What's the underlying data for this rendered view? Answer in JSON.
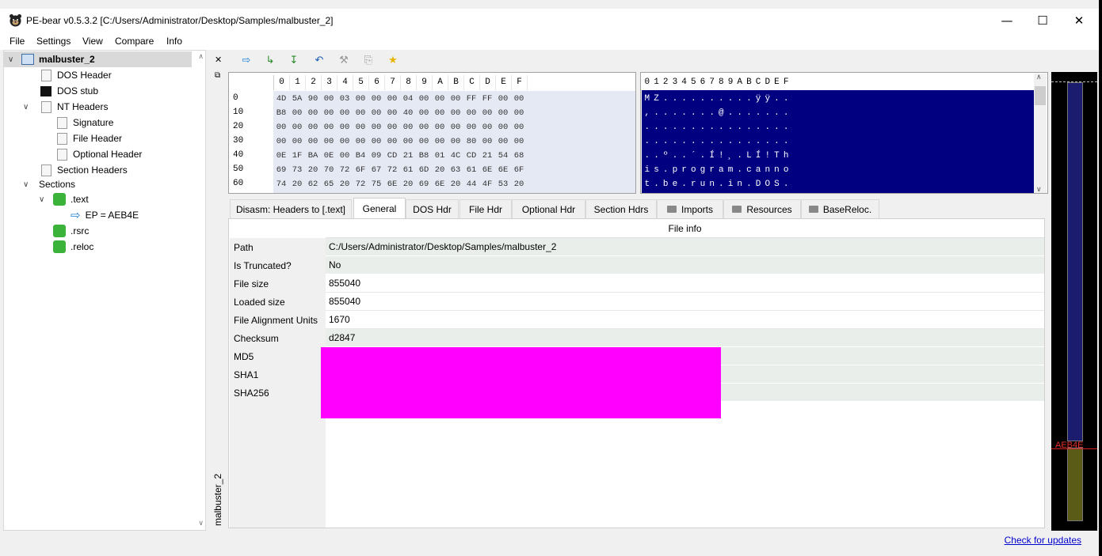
{
  "window": {
    "title": "PE-bear v0.5.3.2 [C:/Users/Administrator/Desktop/Samples/malbuster_2]",
    "controls": {
      "minimize": "—",
      "maximize": "☐",
      "close": "✕"
    }
  },
  "menu": [
    "File",
    "Settings",
    "View",
    "Compare",
    "Info"
  ],
  "tree": {
    "root": "malbuster_2",
    "items": {
      "dos_header": "DOS Header",
      "dos_stub": "DOS stub",
      "nt_headers": "NT Headers",
      "signature": "Signature",
      "file_header": "File Header",
      "optional_header": "Optional Header",
      "section_headers": "Section Headers",
      "sections": "Sections",
      "text": ".text",
      "ep": "EP = AEB4E",
      "rsrc": ".rsrc",
      "reloc": ".reloc"
    }
  },
  "side_strip": {
    "close": "✕",
    "float": "⧉",
    "vertical_label": "malbuster_2"
  },
  "toolbar": [
    "go-to-arrow-icon",
    "add-section-icon",
    "save-icon",
    "undo-icon",
    "pin-icon",
    "copy-icon",
    "star-icon"
  ],
  "hex": {
    "columns": [
      "0",
      "1",
      "2",
      "3",
      "4",
      "5",
      "6",
      "7",
      "8",
      "9",
      "A",
      "B",
      "C",
      "D",
      "E",
      "F"
    ],
    "rows": [
      {
        "offset": "0",
        "bytes": [
          "4D",
          "5A",
          "90",
          "00",
          "03",
          "00",
          "00",
          "00",
          "04",
          "00",
          "00",
          "00",
          "FF",
          "FF",
          "00",
          "00"
        ]
      },
      {
        "offset": "10",
        "bytes": [
          "B8",
          "00",
          "00",
          "00",
          "00",
          "00",
          "00",
          "00",
          "40",
          "00",
          "00",
          "00",
          "00",
          "00",
          "00",
          "00"
        ]
      },
      {
        "offset": "20",
        "bytes": [
          "00",
          "00",
          "00",
          "00",
          "00",
          "00",
          "00",
          "00",
          "00",
          "00",
          "00",
          "00",
          "00",
          "00",
          "00",
          "00"
        ]
      },
      {
        "offset": "30",
        "bytes": [
          "00",
          "00",
          "00",
          "00",
          "00",
          "00",
          "00",
          "00",
          "00",
          "00",
          "00",
          "00",
          "80",
          "00",
          "00",
          "00"
        ]
      },
      {
        "offset": "40",
        "bytes": [
          "0E",
          "1F",
          "BA",
          "0E",
          "00",
          "B4",
          "09",
          "CD",
          "21",
          "B8",
          "01",
          "4C",
          "CD",
          "21",
          "54",
          "68"
        ]
      },
      {
        "offset": "50",
        "bytes": [
          "69",
          "73",
          "20",
          "70",
          "72",
          "6F",
          "67",
          "72",
          "61",
          "6D",
          "20",
          "63",
          "61",
          "6E",
          "6E",
          "6F"
        ]
      },
      {
        "offset": "60",
        "bytes": [
          "74",
          "20",
          "62",
          "65",
          "20",
          "72",
          "75",
          "6E",
          "20",
          "69",
          "6E",
          "20",
          "44",
          "4F",
          "53",
          "20"
        ]
      }
    ]
  },
  "ascii": {
    "columns": [
      "0",
      "1",
      "2",
      "3",
      "4",
      "5",
      "6",
      "7",
      "8",
      "9",
      "A",
      "B",
      "C",
      "D",
      "E",
      "F"
    ],
    "rows": [
      [
        "M",
        "Z",
        ".",
        ".",
        ".",
        ".",
        ".",
        ".",
        ".",
        ".",
        ".",
        ".",
        "ÿ",
        "ÿ",
        ".",
        "."
      ],
      [
        ",",
        ".",
        ".",
        ".",
        ".",
        ".",
        ".",
        ".",
        "@",
        ".",
        ".",
        ".",
        ".",
        ".",
        ".",
        "."
      ],
      [
        ".",
        ".",
        ".",
        ".",
        ".",
        ".",
        ".",
        ".",
        ".",
        ".",
        ".",
        ".",
        ".",
        ".",
        ".",
        "."
      ],
      [
        ".",
        ".",
        ".",
        ".",
        ".",
        ".",
        ".",
        ".",
        ".",
        ".",
        ".",
        ".",
        ".",
        ".",
        ".",
        "."
      ],
      [
        ".",
        ".",
        "º",
        ".",
        ".",
        "´",
        ".",
        "Í",
        "!",
        "¸",
        ".",
        "L",
        "Í",
        "!",
        "T",
        "h"
      ],
      [
        "i",
        "s",
        ".",
        "p",
        "r",
        "o",
        "g",
        "r",
        "a",
        "m",
        ".",
        "c",
        "a",
        "n",
        "n",
        "o"
      ],
      [
        "t",
        ".",
        "b",
        "e",
        ".",
        "r",
        "u",
        "n",
        ".",
        "i",
        "n",
        ".",
        "D",
        "O",
        "S",
        "."
      ]
    ]
  },
  "tabs": [
    {
      "label": "Disasm: Headers to [.text]",
      "folder": false
    },
    {
      "label": "General",
      "folder": false,
      "active": true
    },
    {
      "label": "DOS Hdr",
      "folder": false
    },
    {
      "label": "File Hdr",
      "folder": false
    },
    {
      "label": "Optional Hdr",
      "folder": false
    },
    {
      "label": "Section Hdrs",
      "folder": false
    },
    {
      "label": "Imports",
      "folder": true
    },
    {
      "label": "Resources",
      "folder": true
    },
    {
      "label": "BaseReloc.",
      "folder": true
    }
  ],
  "file_info": {
    "header": "File info",
    "rows": [
      {
        "label": "Path",
        "value": "C:/Users/Administrator/Desktop/Samples/malbuster_2"
      },
      {
        "label": "Is Truncated?",
        "value": "No"
      },
      {
        "label": "File size",
        "value": "855040"
      },
      {
        "label": "Loaded size",
        "value": "855040"
      },
      {
        "label": "File Alignment Units",
        "value": "1670"
      },
      {
        "label": "Checksum",
        "value": "d2847"
      },
      {
        "label": "MD5",
        "value": ""
      },
      {
        "label": "SHA1",
        "value": ""
      },
      {
        "label": "SHA256",
        "value": ""
      }
    ]
  },
  "map": {
    "ep_label": "AEB4E",
    "colors": {
      "code": "#1c1c6e",
      "data": "#5b5b18",
      "ep_line": "#d42020"
    }
  },
  "status": {
    "update_link": "Check for updates"
  }
}
